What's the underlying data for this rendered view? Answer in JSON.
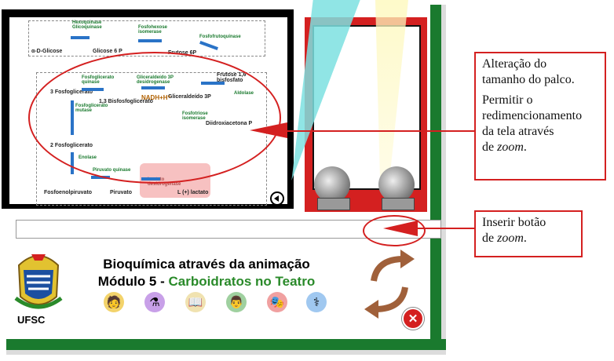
{
  "stage": {
    "molecules": {
      "glucose": "α-D-Glicose",
      "g6p": "Glicose 6 P",
      "f6p": "Frutose 6P",
      "f16bp": "Frutose 1,6 bisfosfato",
      "g3p_left": "3 Fosfoglicerato",
      "bpg": "1,3 Bisfosfoglicerato",
      "gap": "Gliceraldeído 3P",
      "dhap": "Diidroxiacetona P",
      "pg2": "2 Fosfoglicerato",
      "pep": "Fosfoenolpiruvato",
      "pyruvate": "Piruvato",
      "lactate": "L (+) lactato"
    },
    "enzymes": {
      "hexo": "Hexoquinase Glicoquinase",
      "iso1": "Fosfohexose isomerase",
      "pfk": "Fosfofrutoquinase",
      "pgk": "Fosfoglicerato quinase",
      "gapdh": "Gliceraldeído 3P desidrogenase",
      "nadh": "NADH+H⁺",
      "aldolase": "Aldolase",
      "tpi": "Fosfotriose isomerase",
      "mutase": "Fosfoglicerato mutase",
      "enolase": "Enolase",
      "pk": "Piruvato quinase",
      "ldh": "Lactato desidrogenase"
    }
  },
  "callouts": {
    "resize_line1": "Alteração do",
    "resize_line2": "tamanho do palco.",
    "zoom_line1": "Permitir o",
    "zoom_line2": "redimencionamento",
    "zoom_line3": "da tela através",
    "zoom_line4_pre": "de ",
    "zoom_line4_em": "zoom",
    "zoom_line4_post": ".",
    "button_line1": "Inserir botão",
    "button_line2_pre": "de ",
    "button_line2_em": "zoom",
    "button_line2_post": "."
  },
  "title": {
    "line1": "Bioquímica através da animação",
    "line2_prefix": "Módulo 5 - ",
    "line2_green": "Carboidratos no Teatro"
  },
  "logo": {
    "text": "UFSC"
  },
  "nav_icons": [
    "character-icon",
    "flask-icon",
    "book-icon",
    "scientist-icon",
    "theatre-masks-icon",
    "doctor-icon"
  ],
  "colors": {
    "frame_green": "#1a7a2e",
    "accent_red": "#d42020",
    "title_green": "#2a8a2a",
    "arrow_brown": "#a0603a"
  }
}
